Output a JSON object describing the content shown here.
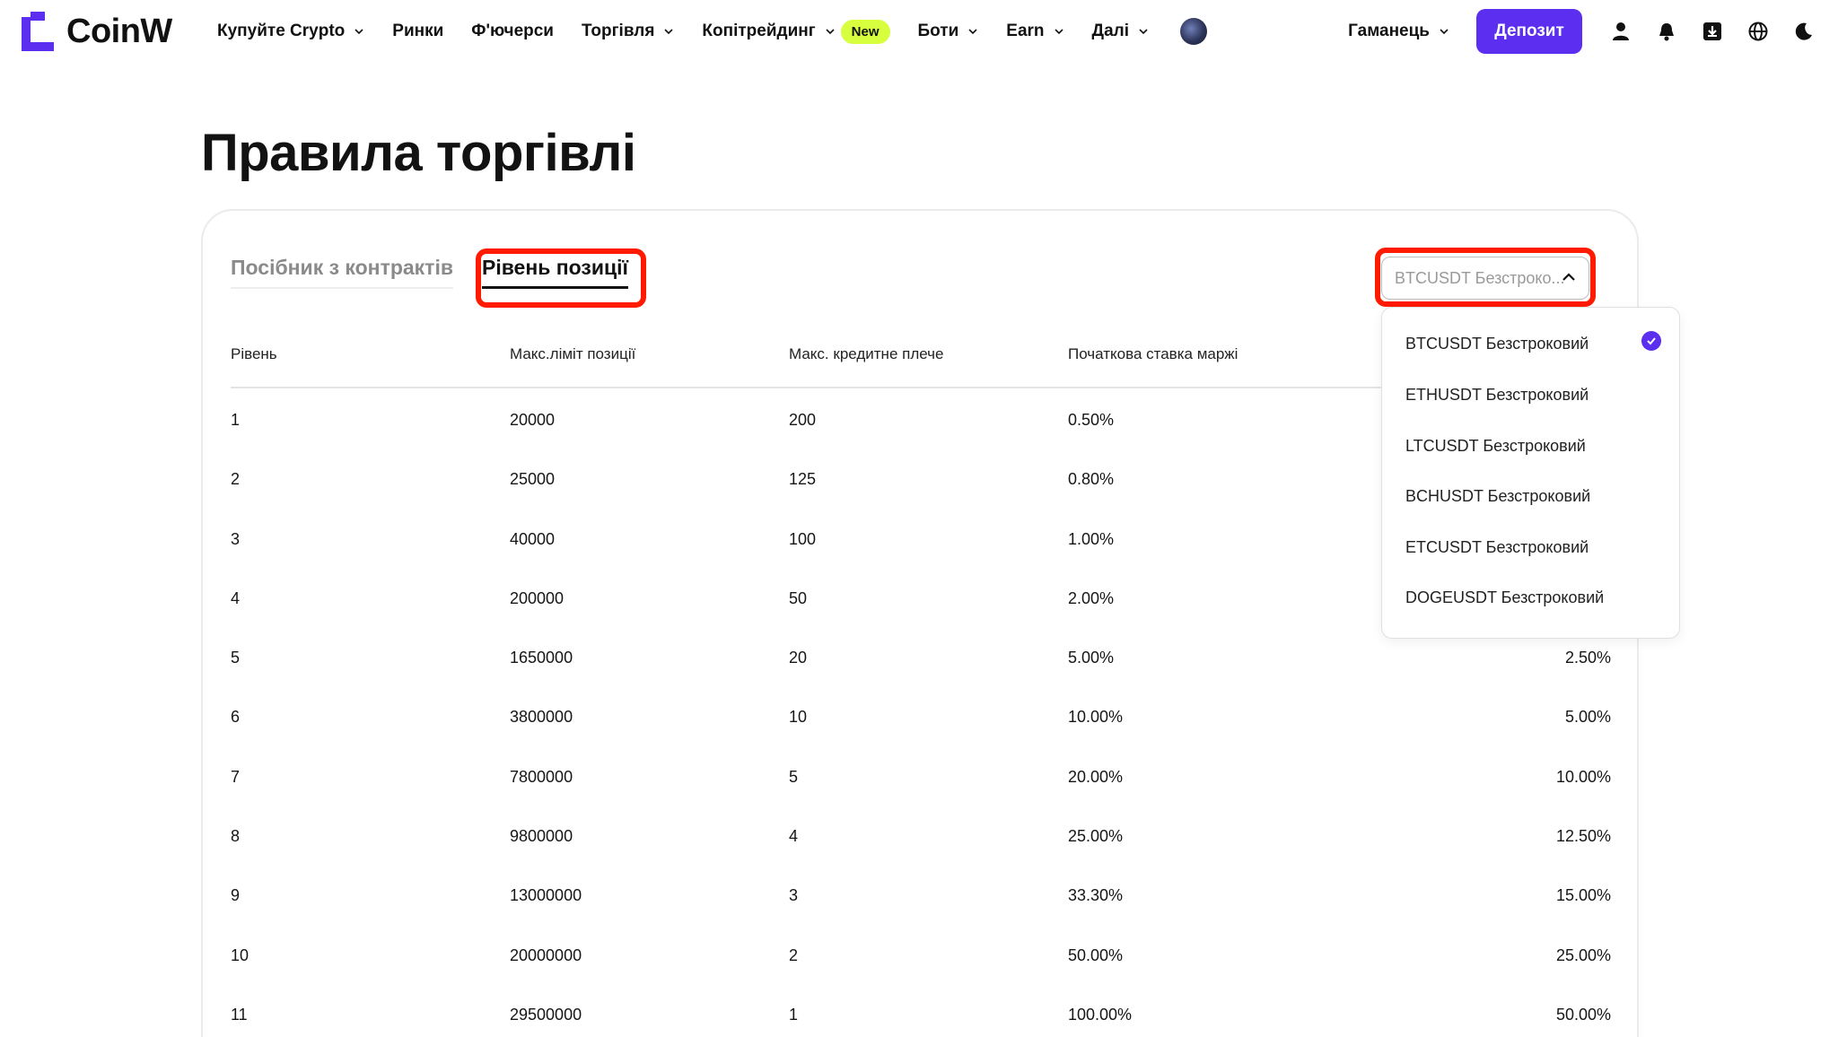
{
  "brand": {
    "name": "CoinW",
    "accent": "#5b2ef0"
  },
  "nav": {
    "items": [
      {
        "label": "Купуйте Crypto",
        "dropdown": true
      },
      {
        "label": "Ринки",
        "dropdown": false
      },
      {
        "label": "Ф'ючерси",
        "dropdown": false
      },
      {
        "label": "Торгівля",
        "dropdown": true
      },
      {
        "label": "Копітрейдинг",
        "dropdown": true,
        "badge": "New"
      },
      {
        "label": "Боти",
        "dropdown": true
      },
      {
        "label": "Earn",
        "dropdown": true
      },
      {
        "label": "Далі",
        "dropdown": true
      }
    ],
    "wallet_label": "Гаманець",
    "deposit_label": "Депозит",
    "icons": [
      "user-icon",
      "bell-icon",
      "download-icon",
      "globe-icon",
      "moon-icon"
    ]
  },
  "page": {
    "title": "Правила торгівлі"
  },
  "tabs": [
    {
      "label": "Посібник з контрактів",
      "active": false
    },
    {
      "label": "Рівень позиції",
      "active": true
    }
  ],
  "select": {
    "value": "BTCUSDT Безстроко..."
  },
  "table": {
    "headers": [
      "Рівень",
      "Макс.ліміт позиції",
      "Макс. кредитне плече",
      "Початкова ставка маржі"
    ],
    "rows": [
      [
        "1",
        "20000",
        "200",
        "0.50%",
        ""
      ],
      [
        "2",
        "25000",
        "125",
        "0.80%",
        ""
      ],
      [
        "3",
        "40000",
        "100",
        "1.00%",
        ""
      ],
      [
        "4",
        "200000",
        "50",
        "2.00%",
        ""
      ],
      [
        "5",
        "1650000",
        "20",
        "5.00%",
        "2.50%"
      ],
      [
        "6",
        "3800000",
        "10",
        "10.00%",
        "5.00%"
      ],
      [
        "7",
        "7800000",
        "5",
        "20.00%",
        "10.00%"
      ],
      [
        "8",
        "9800000",
        "4",
        "25.00%",
        "12.50%"
      ],
      [
        "9",
        "13000000",
        "3",
        "33.30%",
        "15.00%"
      ],
      [
        "10",
        "20000000",
        "2",
        "50.00%",
        "25.00%"
      ],
      [
        "11",
        "29500000",
        "1",
        "100.00%",
        "50.00%"
      ]
    ]
  },
  "dropdown": {
    "options": [
      {
        "label": "BTCUSDT Безстроковий",
        "selected": true
      },
      {
        "label": "ETHUSDT Безстроковий",
        "selected": false
      },
      {
        "label": "LTCUSDT Безстроковий",
        "selected": false
      },
      {
        "label": "BCHUSDT Безстроковий",
        "selected": false
      },
      {
        "label": "ETCUSDT Безстроковий",
        "selected": false
      },
      {
        "label": "DOGEUSDT Безстроковий",
        "selected": false
      }
    ]
  },
  "annotations": {
    "highlight_color": "#ff1a00"
  }
}
